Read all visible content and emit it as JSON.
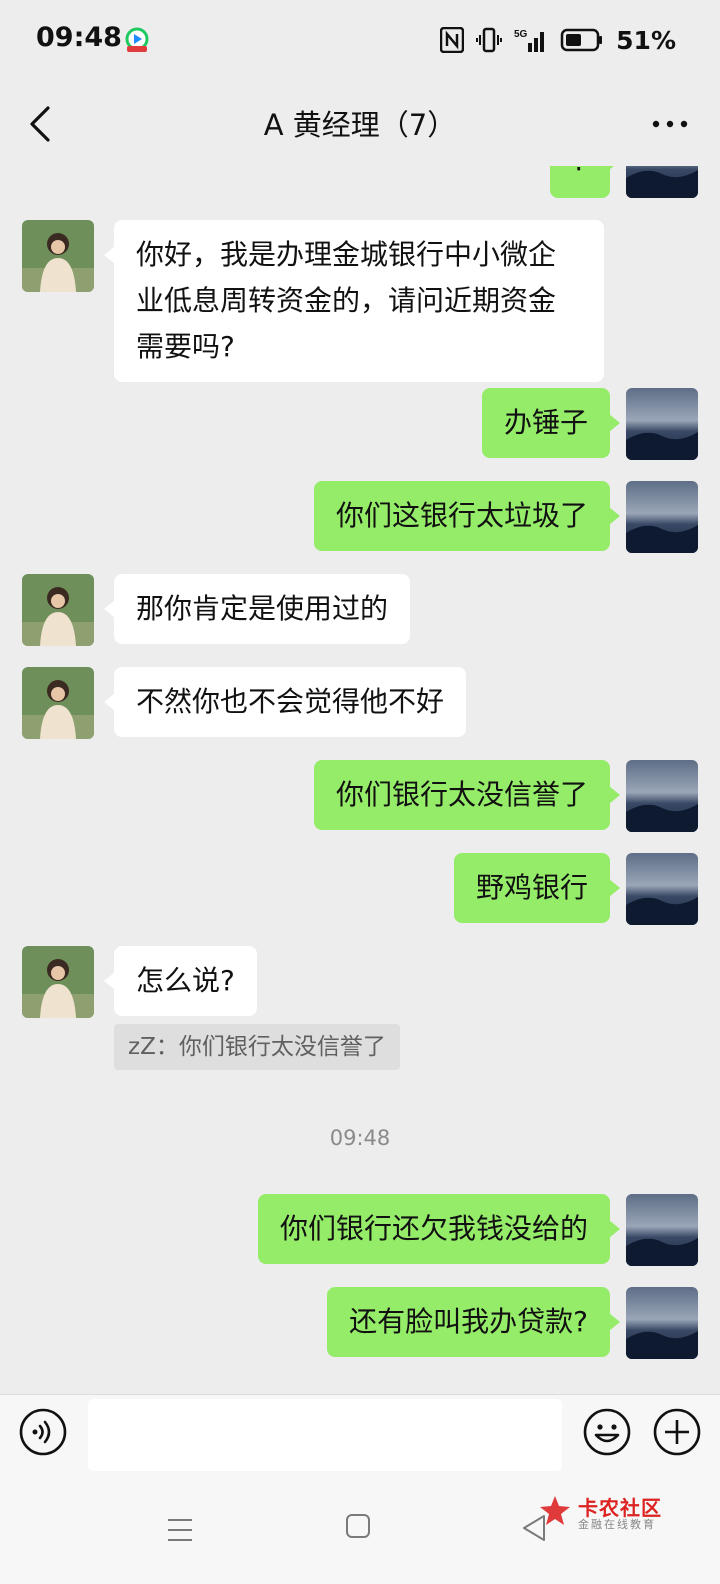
{
  "status_bar": {
    "time": "09:48",
    "network": "5G",
    "battery": "51%",
    "icons": [
      "nfc-icon",
      "vibrate-icon",
      "signal-icon",
      "battery-icon"
    ]
  },
  "header": {
    "title": "A  黄经理（7）",
    "back_icon": "chevron-left-icon",
    "more_icon": "more-dots-icon"
  },
  "messages": [
    {
      "sender": "self",
      "text": "?"
    },
    {
      "sender": "other",
      "text": "你好，我是办理金城银行中小微企业低息周转资金的，请问近期资金需要吗?"
    },
    {
      "sender": "self",
      "text": "办锤子"
    },
    {
      "sender": "self",
      "text": "你们这银行太垃圾了"
    },
    {
      "sender": "other",
      "text": "那你肯定是使用过的"
    },
    {
      "sender": "other",
      "text": "不然你也不会觉得他不好"
    },
    {
      "sender": "self",
      "text": "你们银行太没信誉了"
    },
    {
      "sender": "self",
      "text": "野鸡银行"
    },
    {
      "sender": "other",
      "text": "怎么说?"
    },
    {
      "sender": "self",
      "text": "你们银行还欠我钱没给的"
    },
    {
      "sender": "self",
      "text": "还有脸叫我办贷款?"
    }
  ],
  "quote": "zZ：你们银行太没信誉了",
  "timestamp": "09:48",
  "input": {
    "value": "",
    "placeholder": ""
  },
  "watermark": {
    "title": "卡农社区",
    "subtitle": "金融在线教育"
  },
  "colors": {
    "self_bubble": "#95ec69",
    "other_bubble": "#ffffff",
    "background": "#ededed"
  }
}
